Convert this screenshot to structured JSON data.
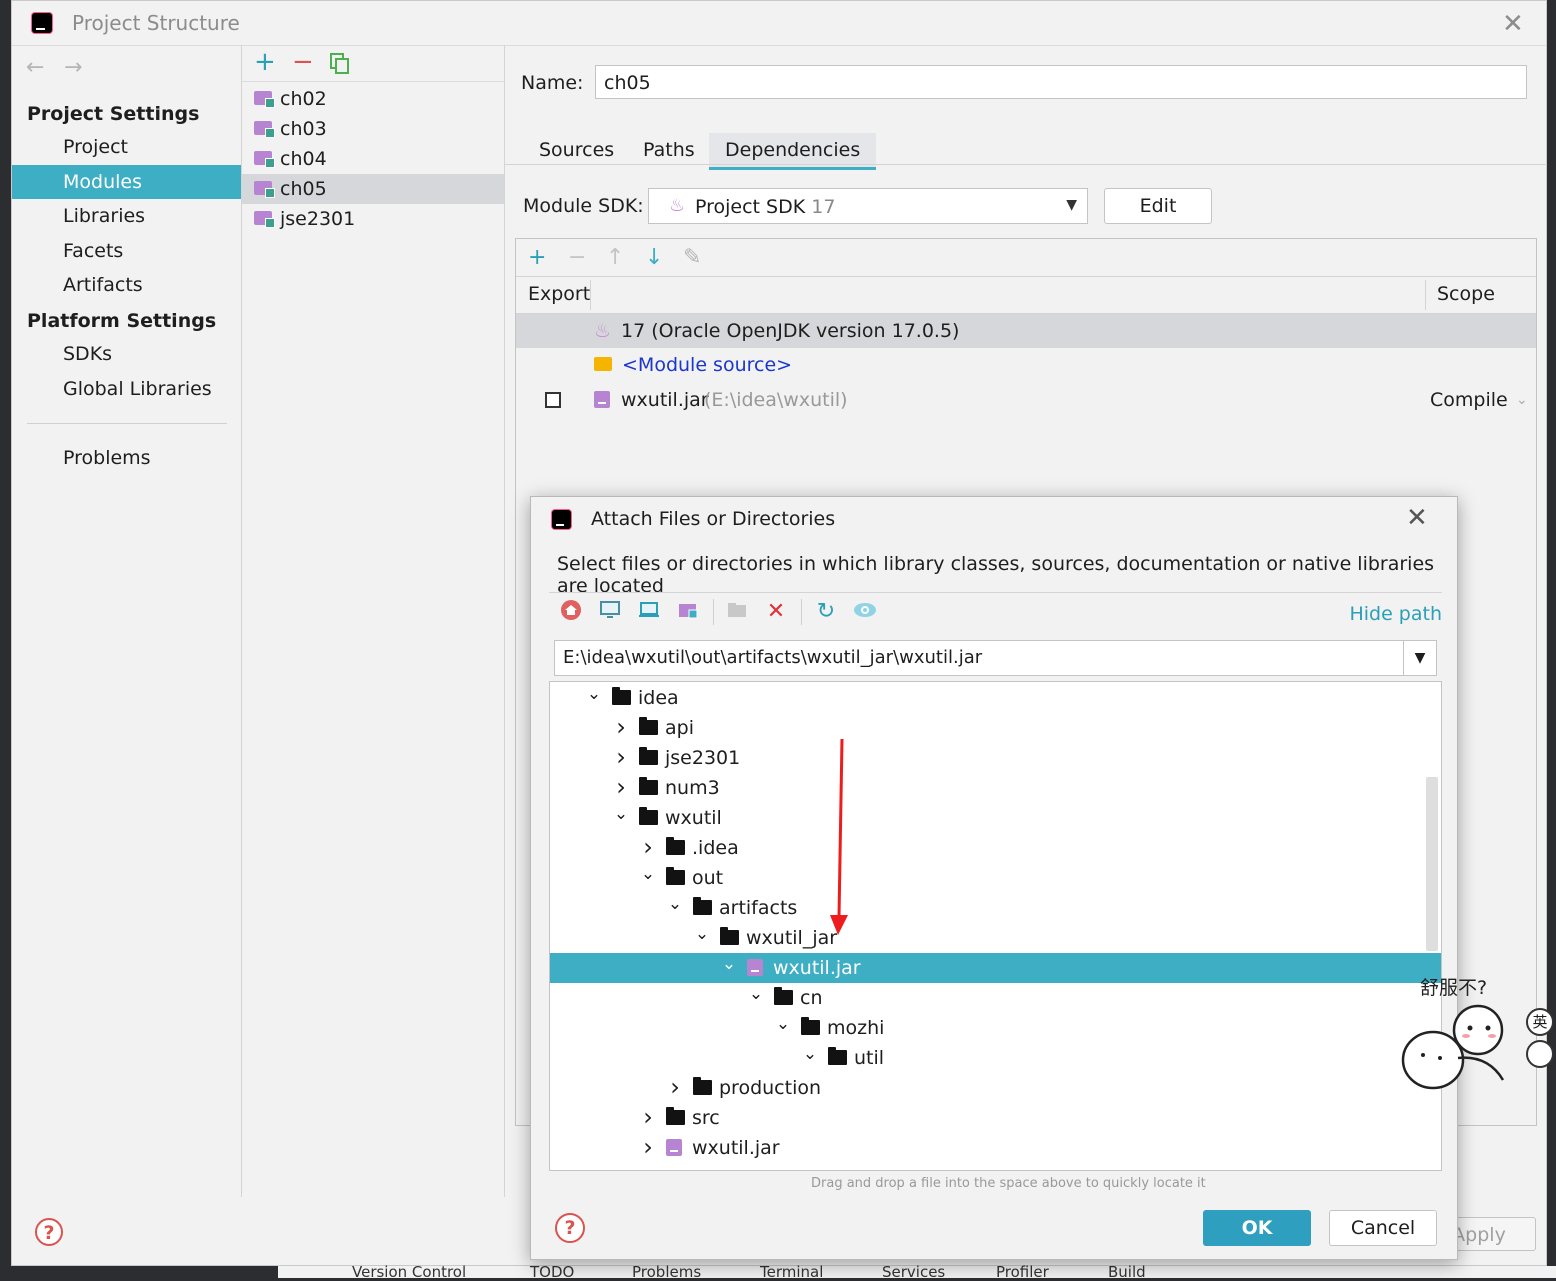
{
  "window": {
    "title": "Project Structure",
    "close": "✕"
  },
  "nav": {
    "back": "←",
    "forward": "→",
    "project_settings": "Project Settings",
    "items1": [
      "Project",
      "Modules",
      "Libraries",
      "Facets",
      "Artifacts"
    ],
    "platform_settings": "Platform Settings",
    "items2": [
      "SDKs",
      "Global Libraries"
    ],
    "problems": "Problems",
    "selected": "Modules"
  },
  "modules": {
    "add": "+",
    "remove": "−",
    "items": [
      "ch02",
      "ch03",
      "ch04",
      "ch05",
      "jse2301"
    ],
    "selected": "ch05"
  },
  "detail": {
    "name_label": "Name:",
    "name_value": "ch05",
    "tabs": [
      "Sources",
      "Paths",
      "Dependencies"
    ],
    "active_tab": "Dependencies",
    "sdk_label": "Module SDK:",
    "sdk_value": "Project SDK",
    "sdk_version": "17",
    "edit_label": "Edit",
    "dep_tool": {
      "add": "+",
      "remove": "−",
      "up": "↑",
      "down": "↓",
      "edit": "✎"
    },
    "columns": {
      "export": "Export",
      "scope": "Scope"
    },
    "rows": [
      {
        "name": "17 (Oracle OpenJDK version 17.0.5)",
        "path": "",
        "scope": ""
      },
      {
        "name": "<Module source>",
        "path": "",
        "scope": ""
      },
      {
        "name": "wxutil.jar",
        "path": "(E:\\idea\\wxutil)",
        "scope": "Compile"
      }
    ],
    "apply_label": "Apply"
  },
  "dialog": {
    "title": "Attach Files or Directories",
    "close": "✕",
    "description": "Select files or directories in which library classes, sources, documentation or native libraries are located",
    "hide_path": "Hide path",
    "path": "E:\\idea\\wxutil\\out\\artifacts\\wxutil_jar\\wxutil.jar",
    "tree": [
      {
        "label": "idea",
        "indent": 0,
        "state": "open",
        "type": "folder"
      },
      {
        "label": "api",
        "indent": 1,
        "state": "closed",
        "type": "folder"
      },
      {
        "label": "jse2301",
        "indent": 1,
        "state": "closed",
        "type": "folder"
      },
      {
        "label": "num3",
        "indent": 1,
        "state": "closed",
        "type": "folder"
      },
      {
        "label": "wxutil",
        "indent": 1,
        "state": "open",
        "type": "folder"
      },
      {
        "label": ".idea",
        "indent": 2,
        "state": "closed",
        "type": "folder"
      },
      {
        "label": "out",
        "indent": 2,
        "state": "open",
        "type": "folder"
      },
      {
        "label": "artifacts",
        "indent": 3,
        "state": "open",
        "type": "folder"
      },
      {
        "label": "wxutil_jar",
        "indent": 4,
        "state": "open",
        "type": "folder"
      },
      {
        "label": "wxutil.jar",
        "indent": 5,
        "state": "open",
        "type": "jar",
        "selected": true
      },
      {
        "label": "cn",
        "indent": 6,
        "state": "open",
        "type": "folder"
      },
      {
        "label": "mozhi",
        "indent": 7,
        "state": "open",
        "type": "folder"
      },
      {
        "label": "util",
        "indent": 8,
        "state": "open",
        "type": "folder"
      },
      {
        "label": "production",
        "indent": 3,
        "state": "closed",
        "type": "folder"
      },
      {
        "label": "src",
        "indent": 2,
        "state": "closed",
        "type": "folder"
      },
      {
        "label": "wxutil.jar",
        "indent": 2,
        "state": "closed",
        "type": "jar"
      }
    ],
    "drag_hint": "Drag and drop a file into the space above to quickly locate it",
    "ok_label": "OK",
    "cancel_label": "Cancel"
  },
  "bottom_tabs": [
    "Version Control",
    "TODO",
    "Problems",
    "Terminal",
    "Services",
    "Profiler",
    "Build"
  ],
  "sticker": {
    "text": "舒服不?",
    "side1": "英"
  },
  "colors": {
    "accent": "#3daec4",
    "ok_button": "#2e9fbe",
    "error": "#d9534f",
    "jar": "#b784d1"
  }
}
